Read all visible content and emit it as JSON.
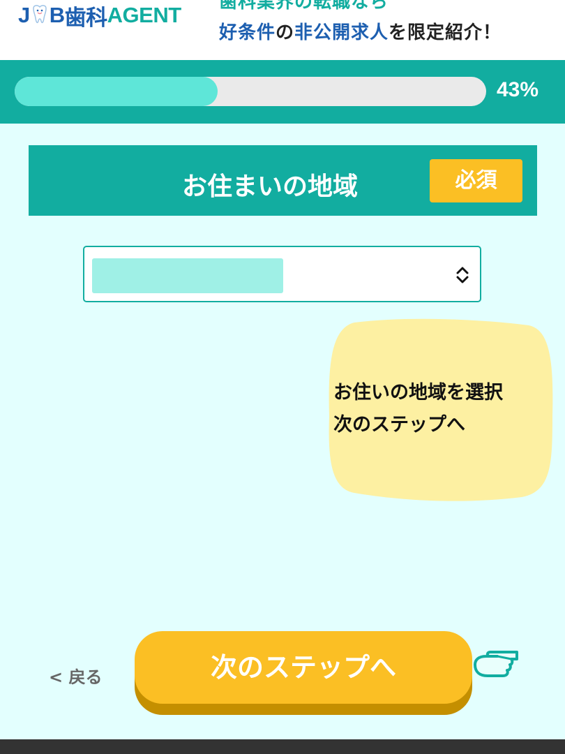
{
  "header": {
    "logo": {
      "jb_left": "J",
      "jb_right": "B",
      "dental": "歯科",
      "agent": "AGENT"
    },
    "tagline_line1": "歯科業界の転職なら",
    "tagline_line2": {
      "part1": "好条件",
      "part2": "の",
      "part3": "非公開求人",
      "part4": "を限定紹介！"
    },
    "colors": {
      "brand_blue": "#1d5fb0",
      "brand_teal": "#12ada0"
    }
  },
  "progress": {
    "value": 0.43,
    "label": "43%",
    "fill_color": "#5ee6d8"
  },
  "section": {
    "title": "お住まいの地域",
    "required_label": "必須"
  },
  "region_select": {
    "selected_value": "",
    "icon": "updown-chevron-icon"
  },
  "tip": {
    "line1": "お住いの地域を選択",
    "line2": "次のステップへ",
    "bubble_color": "#fdf0a2"
  },
  "nav": {
    "back_label": "< 戻る",
    "next_label": "次のステップへ",
    "next_color": "#fbbf24",
    "pointer_icon": "pointing-hand-icon"
  }
}
